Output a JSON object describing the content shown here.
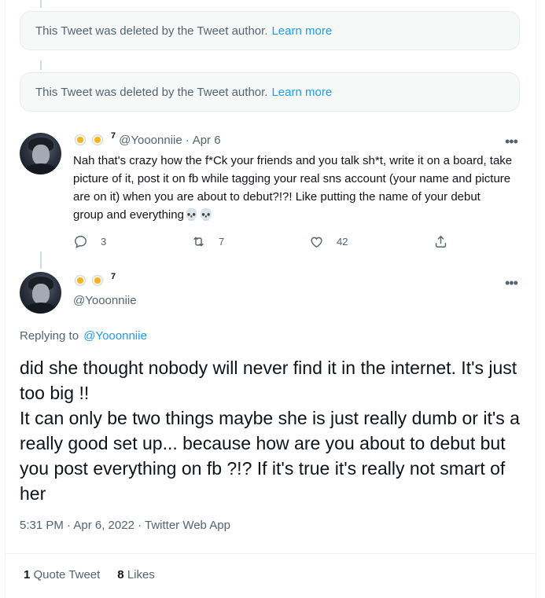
{
  "deleted_notices": [
    {
      "text": "This Tweet was deleted by the Tweet author.",
      "link": "Learn more"
    },
    {
      "text": "This Tweet was deleted by the Tweet author.",
      "link": "Learn more"
    }
  ],
  "tweet1": {
    "display_suffix": "7",
    "handle": "@Yooonniie",
    "separator": "·",
    "date": "Apr 6",
    "more": "•••",
    "text": "Nah that's crazy how the f*Ck your friends and you talk sh*t, write it on a board, take picture of it, post it on fb while tagging your real sns account (your name and picture are on it) when you are about to debut?!?! Like putting the name of your debut group and everything",
    "emoji_tail": "💀💀",
    "reply_count": "3",
    "retweet_count": "7",
    "like_count": "42"
  },
  "main_tweet": {
    "display_suffix": "7",
    "handle": "@Yooonniie",
    "more": "•••",
    "replying_label": "Replying to",
    "replying_handle": "@Yooonniie",
    "text": "did she thought nobody will never find it in the internet. It's just too big !!\nIt can only be two things maybe she is just really dumb or it's a really good set up... because how are you about to debut but you post everything on fb ?!? If it's true it's really not smart of her",
    "timestamp": "5:31 PM · Apr 6, 2022 · Twitter Web App",
    "quote_count": "1",
    "quote_label": "Quote Tweet",
    "likes_count": "8",
    "likes_label": "Likes"
  },
  "icons": [
    "daisy-icon",
    "reply-icon",
    "retweet-icon",
    "like-icon",
    "share-icon",
    "more-icon",
    "skull-icon"
  ],
  "colors": {
    "link": "#1d9bf0",
    "muted": "#536471",
    "text": "#0f1419",
    "notice_bg": "#f7f9f9"
  }
}
